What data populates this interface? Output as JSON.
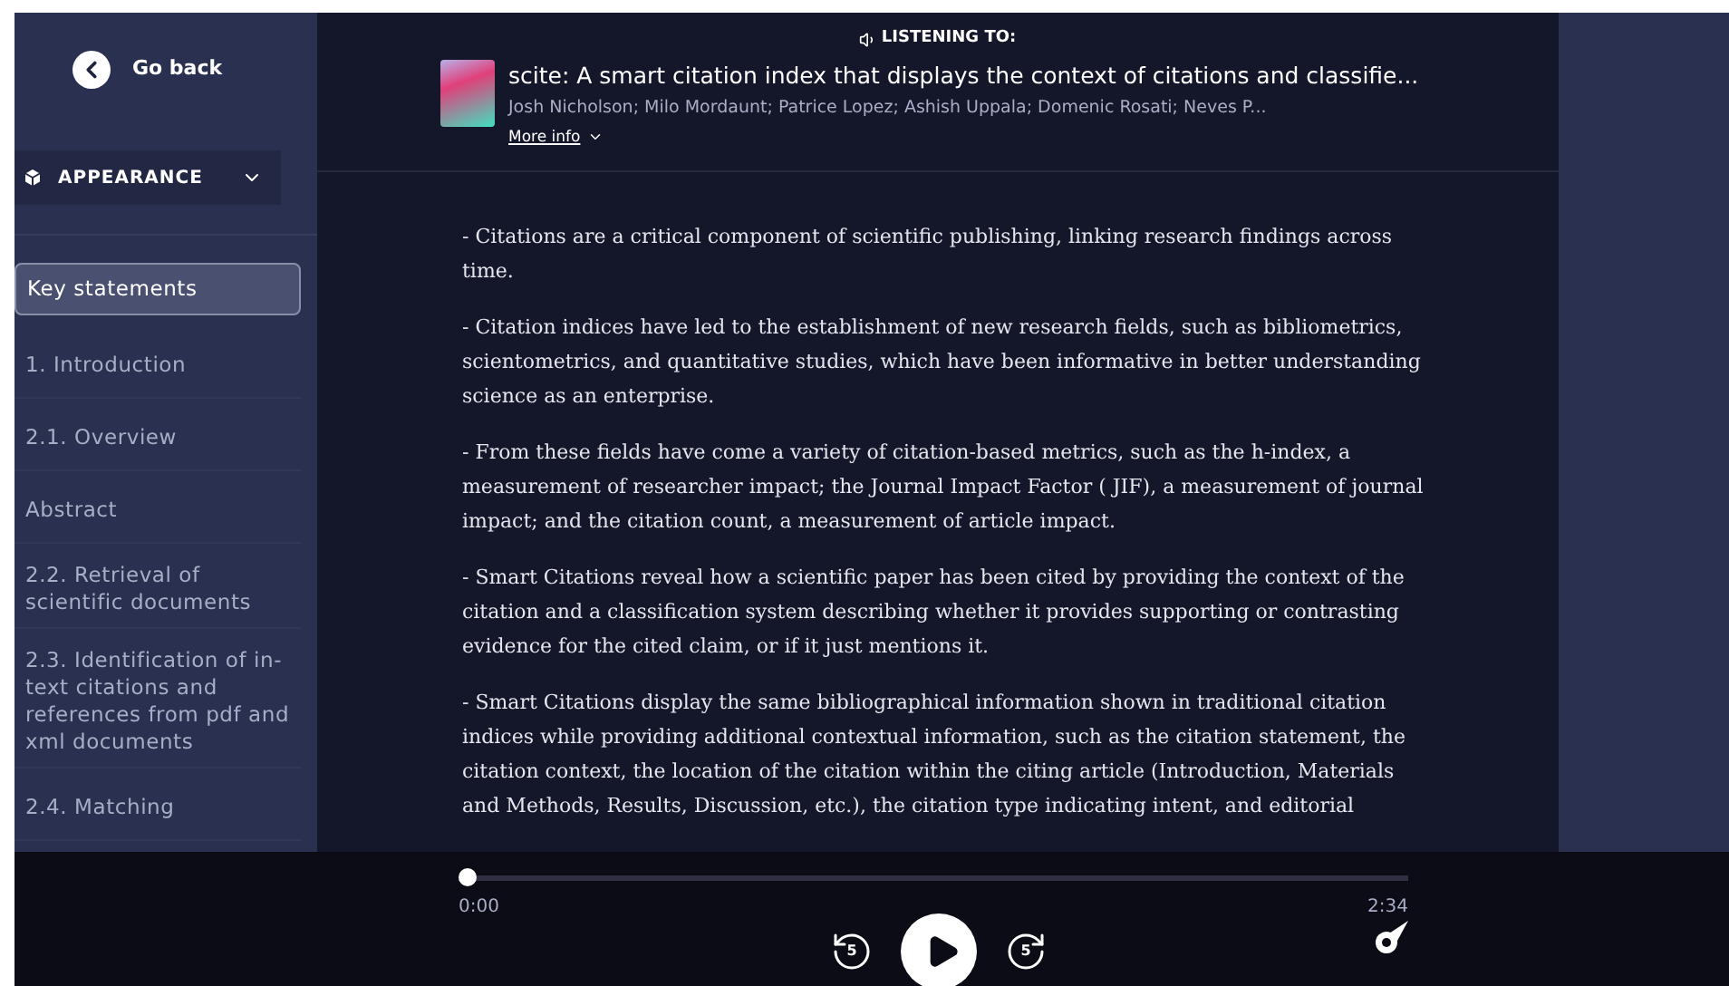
{
  "back_button": {
    "label": "Go back"
  },
  "appearance_menu": {
    "label": "APPEARANCE",
    "expanded": false
  },
  "sidebar": {
    "items": [
      {
        "label": "Key statements",
        "selected": true
      },
      {
        "label": "1. Introduction",
        "selected": false
      },
      {
        "label": "2.1. Overview",
        "selected": false
      },
      {
        "label": "Abstract",
        "selected": false
      },
      {
        "label": "2.2. Retrieval of scientific documents",
        "selected": false
      },
      {
        "label": "2.3. Identification of in-text citations and references from pdf and xml documents",
        "selected": false
      },
      {
        "label": "2.4. Matching",
        "selected": false
      }
    ]
  },
  "now_playing": {
    "heading": "LISTENING TO:",
    "title": "scite: A smart citation index that displays the context of citations and classifie...",
    "authors": "Josh Nicholson; Milo Mordaunt; Patrice Lopez; Ashish Uppala; Domenic Rosati; Neves P...",
    "more_info": "More info"
  },
  "statements": [
    "- Citations are a critical component of scientific publishing, linking research findings across time.",
    "- Citation indices have led to the establishment of new research fields, such as bibliometrics, scientometrics, and quantitative studies, which have been informative in better understanding science as an enterprise.",
    "- From these fields have come a variety of citation-based metrics, such as the h-index, a measurement of researcher impact; the Journal Impact Factor ( JIF), a measurement of journal impact; and the citation count, a measurement of article impact.",
    "- Smart Citations reveal how a scientific paper has been cited by providing the context of the citation and a classification system describing whether it provides supporting or contrasting evidence for the cited claim, or if it just mentions it.",
    "- Smart Citations display the same bibliographical information shown in traditional citation indices while providing additional contextual information, such as the citation statement, the citation context, the location of the citation within the citing article (Introduction, Materials and Methods, Results, Discussion, etc.), the citation type indicating intent, and editorial"
  ],
  "player": {
    "level": 0.0,
    "elapsed": "0:00",
    "duration": "2:34",
    "rewind_seconds": "5",
    "forward_seconds": "5",
    "playing": false
  }
}
